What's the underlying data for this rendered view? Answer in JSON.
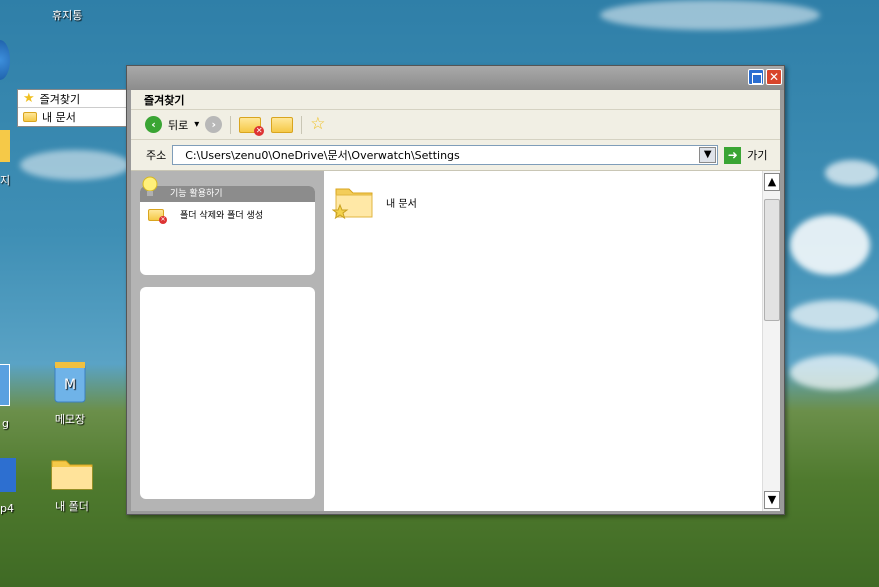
{
  "desktop": {
    "top_labels": [
      "휴지통"
    ],
    "icons": [
      {
        "label": "메모장"
      },
      {
        "label": "내 폴더"
      }
    ],
    "clipped_labels": [
      "g",
      "p4",
      "지"
    ]
  },
  "favorites_panel": {
    "items": [
      {
        "label": "즐겨찾기",
        "icon": "star-icon"
      },
      {
        "label": "내 문서",
        "icon": "folder-icon"
      }
    ]
  },
  "window": {
    "title": "",
    "menu_label": "즐겨찾기",
    "toolbar": {
      "back_label": "뒤로",
      "back_dropdown": "▾"
    },
    "address": {
      "label": "주소",
      "value": "C:\\Users\\zenu0\\OneDrive\\문서\\Overwatch\\Settings",
      "go_label": "가기"
    },
    "tasks": {
      "header": "기능 활용하기",
      "items": [
        {
          "label": "폴더 삭제와 폴더 생성"
        }
      ]
    },
    "files": [
      {
        "name": "내 문서"
      }
    ],
    "colors": {
      "accent_green": "#3aa534",
      "close_red": "#d8452b",
      "maximize_blue": "#2a6dd0"
    }
  }
}
